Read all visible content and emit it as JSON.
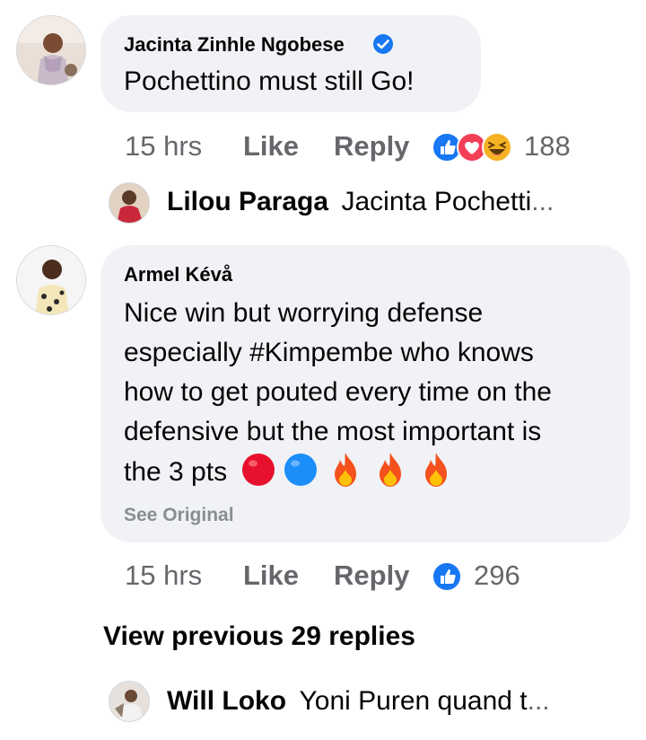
{
  "comments": [
    {
      "author": "Jacinta Zinhle Ngobese",
      "verified": true,
      "text": "Pochettino must still Go!",
      "time": "15 hrs",
      "like_label": "Like",
      "reply_label": "Reply",
      "reactions": [
        "like",
        "love",
        "haha"
      ],
      "reaction_count": "188",
      "reply_preview": {
        "author": "Lilou Paraga",
        "text": "Jacinta Pochetti",
        "ellipsis": "..."
      }
    },
    {
      "author": "Armel Kévå",
      "verified": false,
      "text_lines": [
        "Nice win but worrying defense",
        "especially #Kimpembe who knows",
        "how to get pouted every time on the",
        "defensive but the most important is",
        "the 3 pts"
      ],
      "text_emojis": [
        "red-circle",
        "blue-circle",
        "fire",
        "fire",
        "fire"
      ],
      "see_original_label": "See Original",
      "time": "15 hrs",
      "like_label": "Like",
      "reply_label": "Reply",
      "reactions": [
        "like"
      ],
      "reaction_count": "296"
    }
  ],
  "view_previous_label": "View previous 29 replies",
  "last_reply_preview": {
    "author": "Will Loko",
    "text": "Yoni Puren  quand t",
    "ellipsis": "..."
  },
  "colors": {
    "bubble_bg": "#f0f2f5",
    "meta_text": "#65676b",
    "like_blue": "#1877f2",
    "love_red": "#f33e58",
    "haha_yellow": "#f7b125"
  }
}
